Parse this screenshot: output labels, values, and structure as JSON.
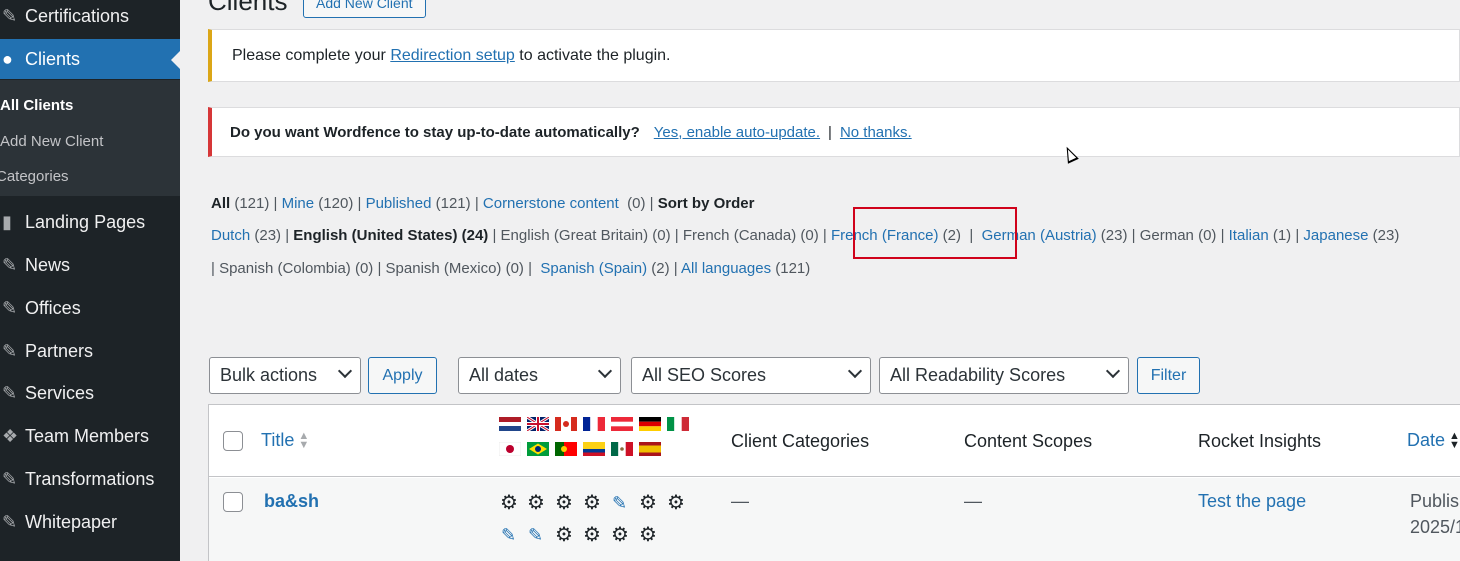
{
  "sidebar": {
    "items": [
      {
        "label": "Certifications",
        "icon": "pin-icon"
      },
      {
        "label": "Clients",
        "icon": "user-icon"
      },
      {
        "label": "Landing Pages",
        "icon": "page-icon"
      },
      {
        "label": "News",
        "icon": "pin-icon"
      },
      {
        "label": "Offices",
        "icon": "pin-icon"
      },
      {
        "label": "Partners",
        "icon": "pin-icon"
      },
      {
        "label": "Services",
        "icon": "pin-icon"
      },
      {
        "label": "Team Members",
        "icon": "groups-icon"
      },
      {
        "label": "Transformations",
        "icon": "pin-icon"
      },
      {
        "label": "Whitepaper",
        "icon": "pin-icon"
      }
    ],
    "submenu": [
      "All Clients",
      "Add New Client",
      "Categories"
    ]
  },
  "header": {
    "title": "Clients",
    "add_new": "Add New Client"
  },
  "notices": {
    "redirection": {
      "before": "Please complete your ",
      "link": "Redirection setup",
      "after": " to activate the plugin."
    },
    "wordfence": {
      "question": "Do you want Wordfence to stay up-to-date automatically?",
      "yes": "Yes, enable auto-update.",
      "sep": "|",
      "no": "No thanks."
    }
  },
  "views": {
    "all": "All",
    "all_count": "(121)",
    "mine": "Mine",
    "mine_count": "(120)",
    "published": "Published",
    "published_count": "(121)",
    "cornerstone": "Cornerstone content",
    "cornerstone_count": "(0)",
    "sort": "Sort by Order"
  },
  "languages": {
    "dutch": "Dutch",
    "dutch_count": "(23)",
    "en_us": "English (United States) (24)",
    "en_gb": "English (Great Britain) (0)",
    "fr_ca": "French (Canada) (0)",
    "fr_fr": "French (France)",
    "fr_fr_count": "(2)",
    "de_at": "German (Austria)",
    "de_at_count": "(23)",
    "de": "German (0)",
    "it": "Italian",
    "it_count": "(1)",
    "ja": "Japanese",
    "ja_count": "(23)",
    "es_co": "Spanish (Colombia) (0)",
    "es_mx": "Spanish (Mexico) (0)",
    "es_es": "Spanish (Spain)",
    "es_es_count": "(2)",
    "all_lang": "All languages",
    "all_lang_count": "(121)"
  },
  "filters": {
    "bulk": "Bulk actions",
    "apply": "Apply",
    "dates": "All dates",
    "seo": "All SEO Scores",
    "readability": "All Readability Scores",
    "filter": "Filter"
  },
  "table": {
    "columns": [
      "Title",
      "Client Categories",
      "Content Scopes",
      "Rocket Insights",
      "Date"
    ],
    "rows": [
      {
        "title": "ba&sh",
        "categories": "—",
        "scopes": "—",
        "insights": "Test the page",
        "date_line1": "Publish",
        "date_line2": "2025/1"
      }
    ]
  },
  "colors": {
    "accent": "#2271b1",
    "sidebar": "#1d2327",
    "warning": "#dba617",
    "error": "#d63638",
    "highlight": "#d0021b"
  }
}
